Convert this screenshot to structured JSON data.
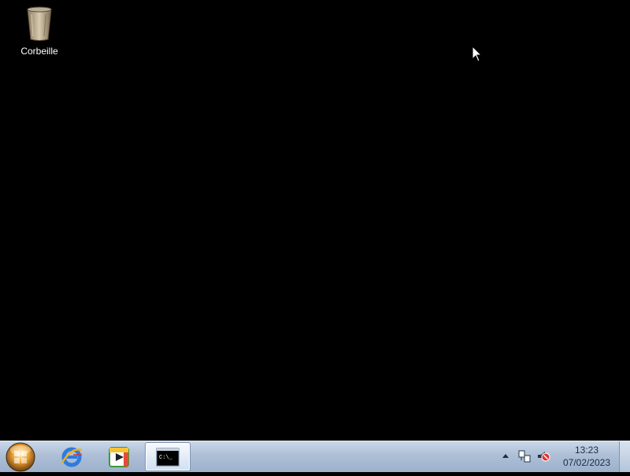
{
  "desktop": {
    "icons": [
      {
        "label": "Corbeille",
        "icon": "recycle-bin-icon"
      }
    ],
    "background_color": "#000000"
  },
  "taskbar": {
    "start": {
      "icon": "windows-start-orb-icon"
    },
    "pinned": [
      {
        "icon": "internet-explorer-icon"
      },
      {
        "icon": "media-player-icon"
      },
      {
        "icon": "command-prompt-icon",
        "active": true,
        "glyph_text": "C:\\_"
      }
    ],
    "tray": {
      "icons": [
        "show-hidden-icons-arrow",
        "network-icon",
        "volume-muted-icon"
      ]
    },
    "clock": {
      "time": "13:23",
      "date": "07/02/2023"
    }
  }
}
